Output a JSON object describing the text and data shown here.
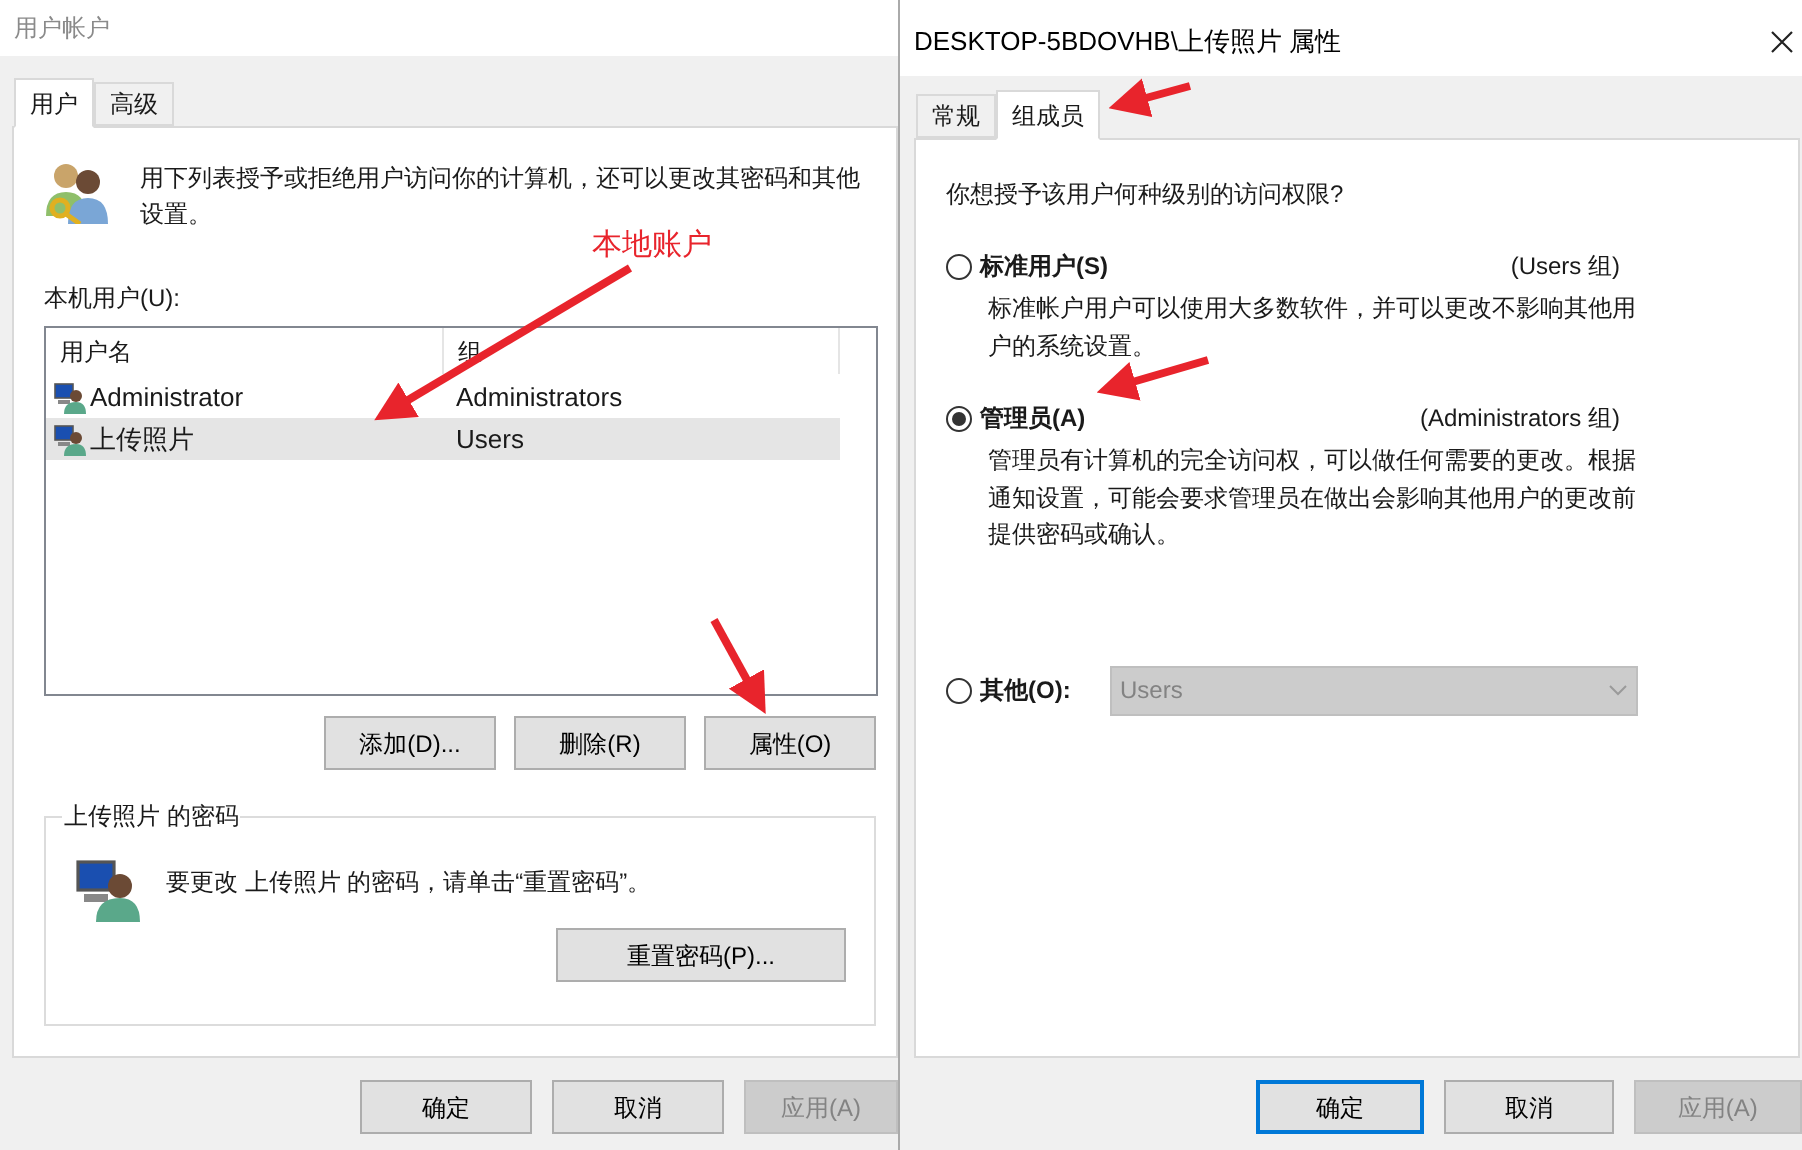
{
  "user_accounts_window": {
    "title": "用户帐户",
    "tabs": [
      {
        "label": "用户",
        "selected": true
      },
      {
        "label": "高级",
        "selected": false
      }
    ],
    "description": "用下列表授予或拒绝用户访问你的计算机，还可以更改其密码和其他设置。",
    "list_label": "本机用户(U):",
    "list": {
      "columns": [
        "用户名",
        "组"
      ],
      "rows": [
        {
          "name": "Administrator",
          "group": "Administrators",
          "selected": false
        },
        {
          "name": "上传照片",
          "group": "Users",
          "selected": true
        }
      ]
    },
    "list_buttons": [
      "添加(D)...",
      "删除(R)",
      "属性(O)"
    ],
    "password_group": {
      "title": "上传照片 的密码",
      "text": "要更改 上传照片 的密码，请单击“重置密码”。",
      "button": "重置密码(P)..."
    },
    "dialog_buttons": [
      {
        "label": "确定",
        "disabled": false
      },
      {
        "label": "取消",
        "disabled": false
      },
      {
        "label": "应用(A)",
        "disabled": true
      }
    ]
  },
  "properties_window": {
    "title": "DESKTOP-5BDOVHB\\上传照片 属性",
    "tabs": [
      {
        "label": "常规",
        "selected": false
      },
      {
        "label": "组成员",
        "selected": true
      }
    ],
    "question": "你想授予该用户何种级别的访问权限?",
    "options": [
      {
        "kind": "described",
        "label": "标准用户(S)",
        "group": "(Users 组)",
        "description": "标准帐户用户可以使用大多数软件，并可以更改不影响其他用户的系统设置。",
        "selected": false
      },
      {
        "kind": "described",
        "label": "管理员(A)",
        "group": "(Administrators 组)",
        "description": "管理员有计算机的完全访问权，可以做任何需要的更改。根据通知设置，可能会要求管理员在做出会影响其他用户的更改前提供密码或确认。",
        "selected": true
      },
      {
        "kind": "dropdown",
        "label": "其他(O):",
        "value": "Users",
        "disabled": true,
        "selected": false
      }
    ],
    "dialog_buttons": [
      {
        "label": "确定",
        "disabled": false,
        "focused": true
      },
      {
        "label": "取消",
        "disabled": false,
        "focused": false
      },
      {
        "label": "应用(A)",
        "disabled": true,
        "focused": false
      }
    ]
  },
  "annotation": {
    "text": "本地账户"
  }
}
